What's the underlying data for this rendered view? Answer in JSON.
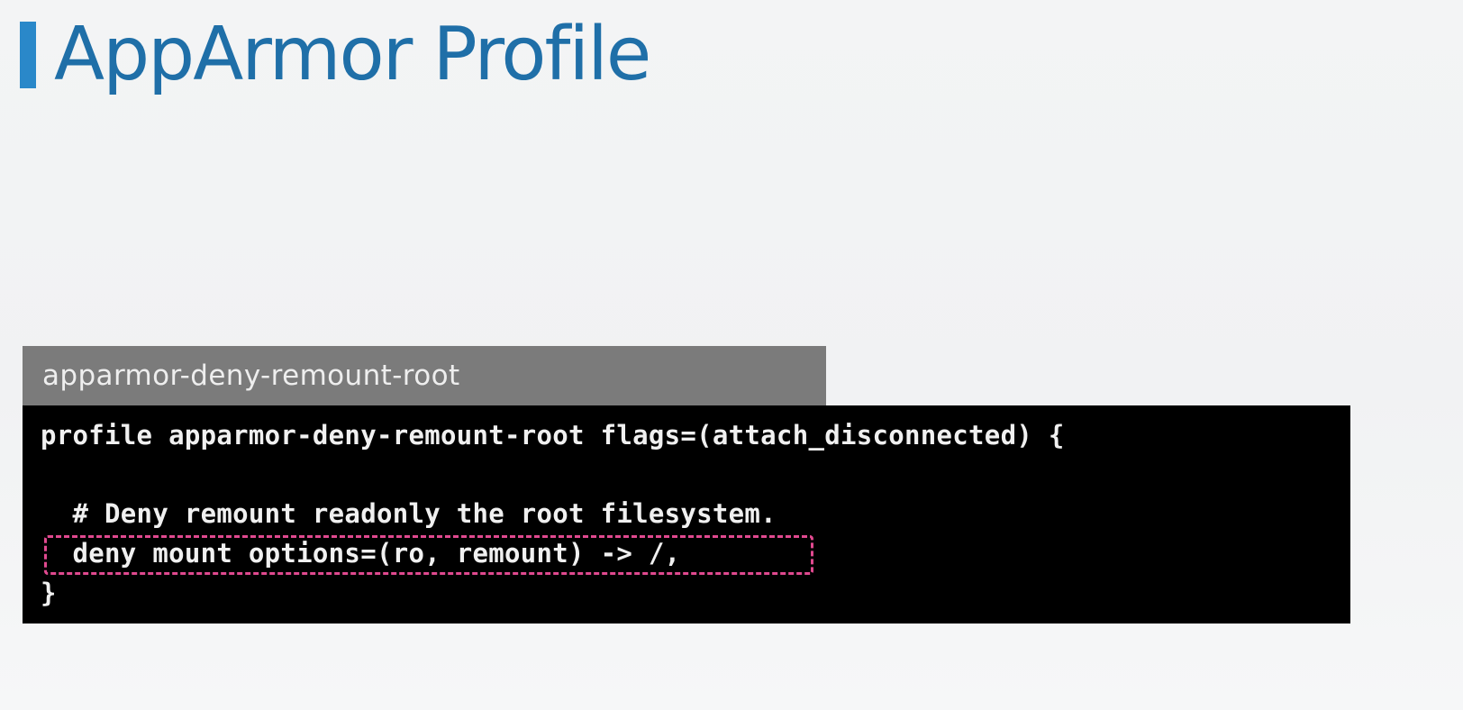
{
  "slide": {
    "title": "AppArmor Profile",
    "accent_color": "#2a88c9"
  },
  "file": {
    "tab_label": "apparmor-deny-remount-root"
  },
  "code": {
    "lines": [
      "profile apparmor-deny-remount-root flags=(attach_disconnected) {",
      "",
      "  # Deny remount readonly the root filesystem.",
      "  deny mount options=(ro, remount) -> /,",
      "}"
    ],
    "highlight_color": "#e0498f"
  }
}
